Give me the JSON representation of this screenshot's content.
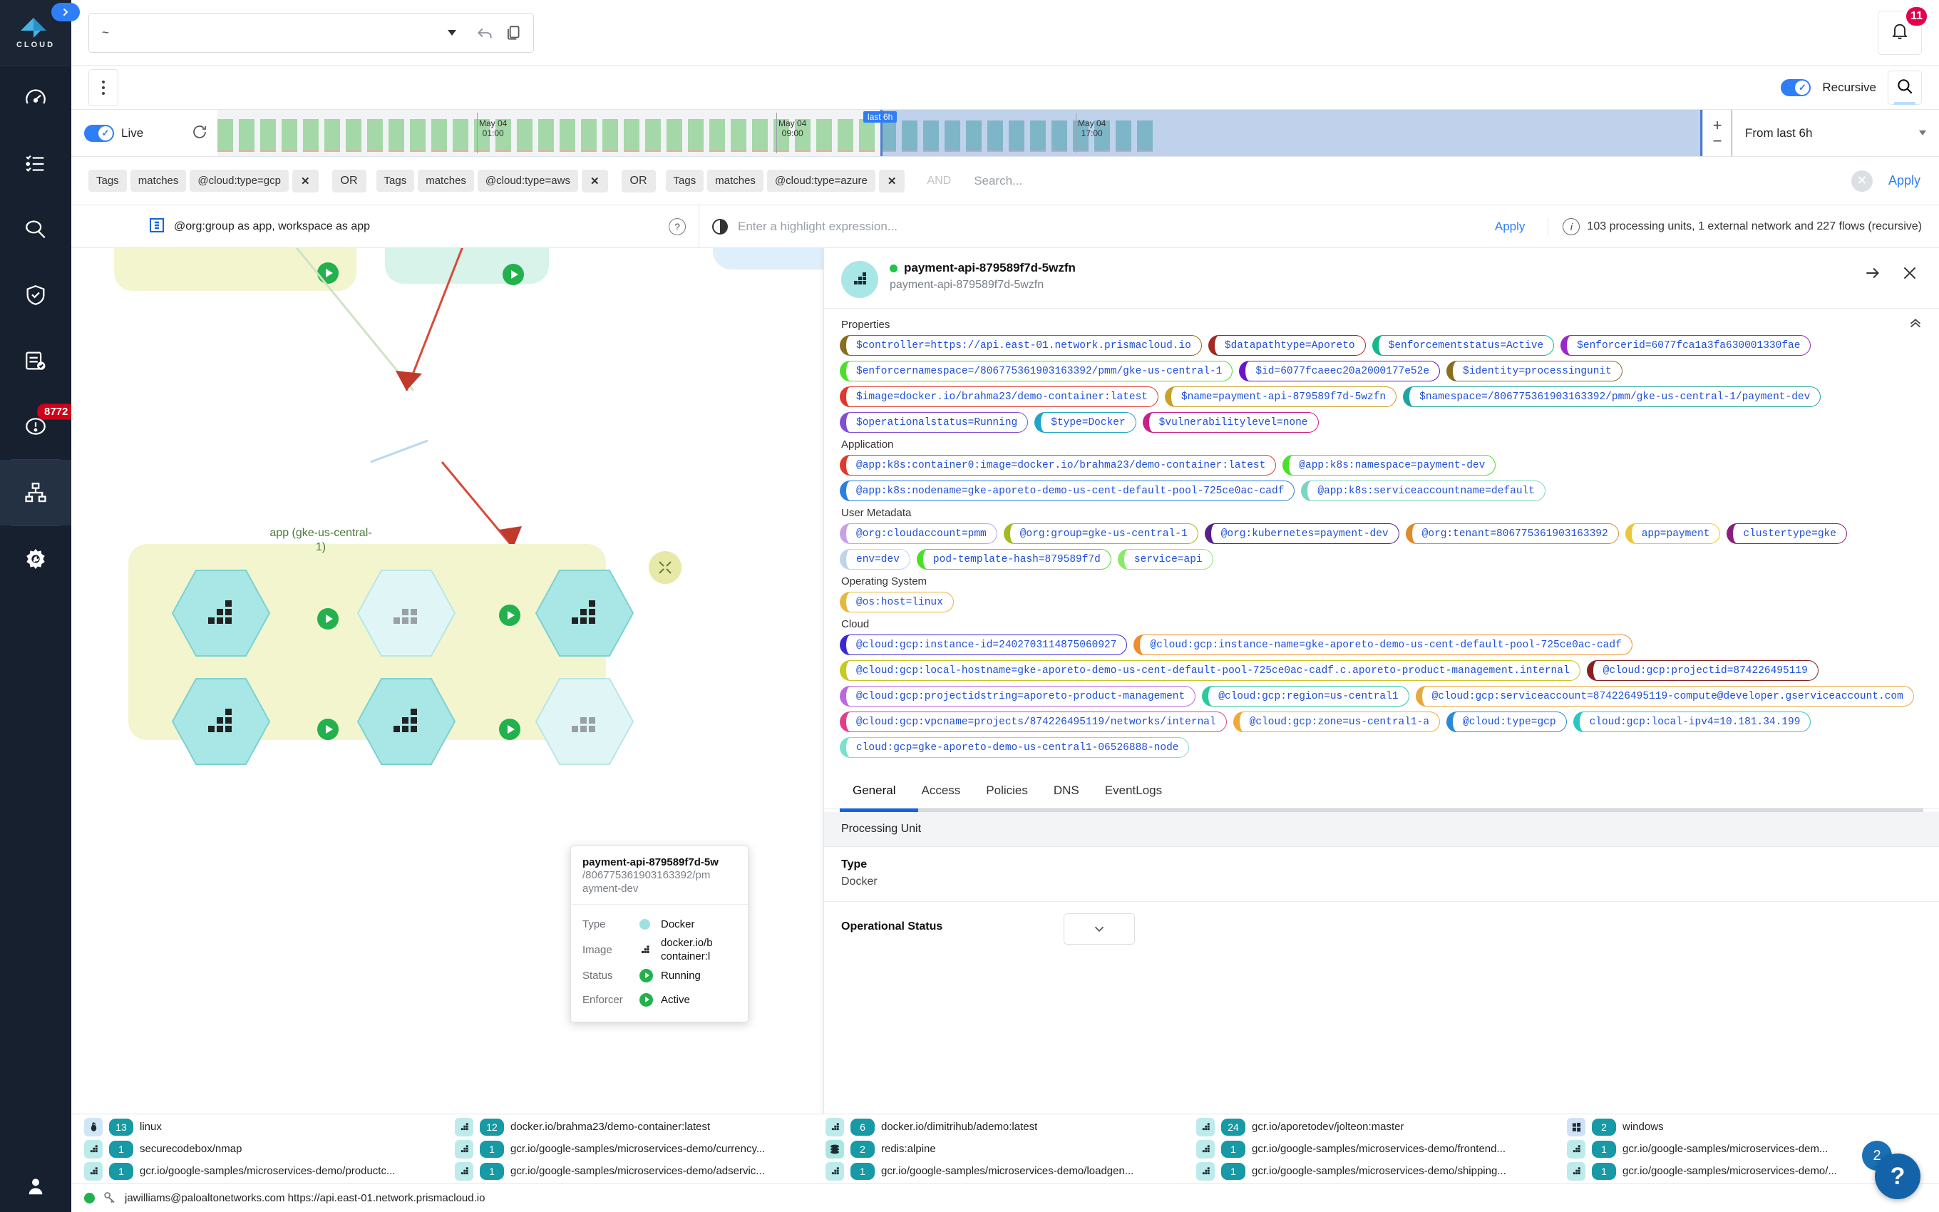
{
  "rail": {
    "logo_text": "CLOUD",
    "items": [
      {
        "name": "dashboard",
        "icon": "gauge-icon"
      },
      {
        "name": "inventory",
        "icon": "list-check-icon"
      },
      {
        "name": "investigate",
        "icon": "magnifier-icon"
      },
      {
        "name": "compliance",
        "icon": "shield-check-icon"
      },
      {
        "name": "reports",
        "icon": "document-check-icon"
      },
      {
        "name": "alerts",
        "icon": "alert-circle-icon",
        "badge": "8772"
      },
      {
        "name": "network-map",
        "icon": "network-topology-icon",
        "active": true
      },
      {
        "name": "settings",
        "icon": "gear-wrench-icon"
      }
    ],
    "expander_icon": "chevron-right-icon",
    "user_icon": "user-avatar-icon"
  },
  "topbar": {
    "scope_value": "~",
    "undo_icon": "undo-arrow-icon",
    "copy_icon": "copy-icon",
    "bell_icon": "bell-icon",
    "bell_badge": "11"
  },
  "subbar": {
    "kebab_icon": "more-vertical-icon",
    "recursive_label": "Recursive",
    "recursive_on": true,
    "search_icon": "search-icon"
  },
  "timeline": {
    "live_label": "Live",
    "live_on": true,
    "refresh_icon": "refresh-icon",
    "selection_badge": "last 6h",
    "tick_left_label_1": "May 04",
    "tick_left_label_2": "01:00",
    "tick_mid_label_1": "May 04",
    "tick_mid_label_2": "09:00",
    "tick_right_label_1": "May 04",
    "tick_right_label_2": "17:00",
    "zoom_in": "+",
    "zoom_out": "−",
    "range_label": "From last 6h"
  },
  "query": {
    "groups": [
      {
        "field": "Tags",
        "op": "matches",
        "value": "@cloud:type=gcp",
        "remove": "✕",
        "joiner": "OR"
      },
      {
        "field": "Tags",
        "op": "matches",
        "value": "@cloud:type=aws",
        "remove": "✕",
        "joiner": "OR"
      },
      {
        "field": "Tags",
        "op": "matches",
        "value": "@cloud:type=azure",
        "remove": "✕",
        "joiner": "AND"
      }
    ],
    "search_placeholder": "Search...",
    "clear_icon": "✕",
    "apply_label": "Apply"
  },
  "highlight": {
    "scope_icon": "workspace-icon",
    "scope_text": "@org:group as app,  workspace as app",
    "help_icon": "?",
    "contrast_icon": "contrast-icon",
    "expression_placeholder": "Enter a highlight expression...",
    "apply_label": "Apply",
    "info_icon": "info-icon",
    "info_text": "103 processing units, 1 external network and 227 flows (recursive)"
  },
  "graph": {
    "group_label_line1": "app (gke-us-central-",
    "group_label_line2": "1)",
    "collapse_icon": "collapse-arrows-icon",
    "tooltip": {
      "title": "payment-api-879589f7d-5w",
      "subtitle": "/806775361903163392/pm\nayment-dev",
      "rows": [
        {
          "key": "Type",
          "icon": "teal-dot-icon",
          "value": "Docker"
        },
        {
          "key": "Image",
          "icon": "container-icon",
          "value": "docker.io/b\ncontainer:l"
        },
        {
          "key": "Status",
          "icon": "running-icon",
          "value": "Running"
        },
        {
          "key": "Enforcer",
          "icon": "running-icon",
          "value": "Active"
        }
      ]
    }
  },
  "detail": {
    "avatar_icon": "container-icon",
    "title": "payment-api-879589f7d-5wzfn",
    "subtitle": "payment-api-879589f7d-5wzfn",
    "status_dot_color": "#21c14a",
    "expand_icon": "arrow-right-icon",
    "close_icon": "✕",
    "collapse_icon": "chevron-double-up-icon",
    "sections": [
      {
        "label": "Properties",
        "chips": [
          {
            "text": "$controller=https://api.east-01.network.prismacloud.io",
            "color": "#8a6d1f"
          },
          {
            "text": "$datapathtype=Aporeto",
            "color": "#a22a22"
          },
          {
            "text": "$enforcementstatus=Active",
            "color": "#14b88a"
          },
          {
            "text": "$enforcerid=6077fca1a3fa630001330fae",
            "color": "#9b28c9"
          },
          {
            "text": "$enforcernamespace=/806775361903163392/pmm/gke-us-central-1",
            "color": "#4cdf2a"
          },
          {
            "text": "$id=6077fcaeec20a2000177e52e",
            "color": "#6c14c9"
          },
          {
            "text": "$identity=processingunit",
            "color": "#8a6d1f"
          },
          {
            "text": "$image=docker.io/brahma23/demo-container:latest",
            "color": "#e0382c"
          },
          {
            "text": "$name=payment-api-879589f7d-5wzfn",
            "color": "#c9a227"
          },
          {
            "text": "$namespace=/806775361903163392/pmm/gke-us-central-1/payment-dev",
            "color": "#1fa5a0"
          },
          {
            "text": "$operationalstatus=Running",
            "color": "#7f4fd6"
          },
          {
            "text": "$type=Docker",
            "color": "#1fa5c9"
          },
          {
            "text": "$vulnerabilitylevel=none",
            "color": "#c9208a"
          }
        ]
      },
      {
        "label": "Application",
        "chips": [
          {
            "text": "@app:k8s:container0:image=docker.io/brahma23/demo-container:latest",
            "color": "#e03a2c"
          },
          {
            "text": "@app:k8s:namespace=payment-dev",
            "color": "#4cdf2a"
          },
          {
            "text": "@app:k8s:nodename=gke-aporeto-demo-us-cent-default-pool-725ce0ac-cadf",
            "color": "#2c7fe0"
          },
          {
            "text": "@app:k8s:serviceaccountname=default",
            "color": "#7ad6c2"
          }
        ]
      },
      {
        "label": "User Metadata",
        "chips": [
          {
            "text": "@org:cloudaccount=pmm",
            "color": "#c9a0e8"
          },
          {
            "text": "@org:group=gke-us-central-1",
            "color": "#a8b820"
          },
          {
            "text": "@org:kubernetes=payment-dev",
            "color": "#5a1f8a"
          },
          {
            "text": "@org:tenant=806775361903163392",
            "color": "#e08a2c"
          },
          {
            "text": "app=payment",
            "color": "#e8c83a"
          },
          {
            "text": "clustertype=gke",
            "color": "#8a1f7a"
          },
          {
            "text": "env=dev",
            "color": "#bdd4ea"
          },
          {
            "text": "pod-template-hash=879589f7d",
            "color": "#4cdf2a"
          },
          {
            "text": "service=api",
            "color": "#8ae86a"
          }
        ]
      },
      {
        "label": "Operating System",
        "chips": [
          {
            "text": "@os:host=linux",
            "color": "#e8b83a"
          }
        ]
      },
      {
        "label": "Cloud",
        "chips": [
          {
            "text": "@cloud:gcp:instance-id=2402703114875060927",
            "color": "#3a28d6"
          },
          {
            "text": "@cloud:gcp:instance-name=gke-aporeto-demo-us-cent-default-pool-725ce0ac-cadf",
            "color": "#f08c2a"
          },
          {
            "text": "@cloud:gcp:local-hostname=gke-aporeto-demo-us-cent-default-pool-725ce0ac-cadf.c.aporeto-product-management.internal",
            "color": "#c9c820"
          },
          {
            "text": "@cloud:gcp:projectid=874226495119",
            "color": "#8a1f1f"
          },
          {
            "text": "@cloud:gcp:projectidstring=aporeto-product-management",
            "color": "#b86ae0"
          },
          {
            "text": "@cloud:gcp:region=us-central1",
            "color": "#2ac9a0"
          },
          {
            "text": "@cloud:gcp:serviceaccount=874226495119-compute@developer.gserviceaccount.com",
            "color": "#e8a83a"
          },
          {
            "text": "@cloud:gcp:vpcname=projects/874226495119/networks/internal",
            "color": "#e0408a"
          },
          {
            "text": "@cloud:gcp:zone=us-central1-a",
            "color": "#f0a83a"
          },
          {
            "text": "@cloud:type=gcp",
            "color": "#2a8ad6"
          },
          {
            "text": "cloud:gcp:local-ipv4=10.181.34.199",
            "color": "#2ac9c0"
          },
          {
            "text": "cloud:gcp=gke-aporeto-demo-us-central1-06526888-node",
            "color": "#7ae0d0"
          }
        ]
      }
    ],
    "tabs": [
      {
        "label": "General",
        "active": true
      },
      {
        "label": "Access",
        "active": false
      },
      {
        "label": "Policies",
        "active": false
      },
      {
        "label": "DNS",
        "active": false
      },
      {
        "label": "EventLogs",
        "active": false
      }
    ],
    "section_title": "Processing Unit",
    "fields": [
      {
        "key": "Type",
        "value": "Docker"
      },
      {
        "key": "Operational Status",
        "value": ""
      }
    ],
    "chev_icon": "chevron-down-icon"
  },
  "legend": {
    "items": [
      {
        "icon": "linux-icon",
        "count": "13",
        "label": "linux"
      },
      {
        "icon": "container-icon",
        "count": "12",
        "label": "docker.io/brahma23/demo-container:latest"
      },
      {
        "icon": "container-icon",
        "count": "6",
        "label": "docker.io/dimitrihub/ademo:latest"
      },
      {
        "icon": "container-icon",
        "count": "24",
        "label": "gcr.io/aporetodev/jolteon:master"
      },
      {
        "icon": "windows-icon",
        "count": "2",
        "label": "windows"
      },
      {
        "icon": "container-icon",
        "count": "1",
        "label": "securecodebox/nmap"
      },
      {
        "icon": "container-icon",
        "count": "1",
        "label": "gcr.io/google-samples/microservices-demo/currency..."
      },
      {
        "icon": "redis-icon",
        "count": "2",
        "label": "redis:alpine"
      },
      {
        "icon": "container-icon",
        "count": "1",
        "label": "gcr.io/google-samples/microservices-demo/frontend..."
      },
      {
        "icon": "container-icon",
        "count": "1",
        "label": "gcr.io/google-samples/microservices-dem..."
      },
      {
        "icon": "container-icon",
        "count": "1",
        "label": "gcr.io/google-samples/microservices-demo/productc..."
      },
      {
        "icon": "container-icon",
        "count": "1",
        "label": "gcr.io/google-samples/microservices-demo/adservic..."
      },
      {
        "icon": "container-icon",
        "count": "1",
        "label": "gcr.io/google-samples/microservices-demo/loadgen..."
      },
      {
        "icon": "container-icon",
        "count": "1",
        "label": "gcr.io/google-samples/microservices-demo/shipping..."
      },
      {
        "icon": "container-icon",
        "count": "1",
        "label": "gcr.io/google-samples/microservices-demo/..."
      }
    ]
  },
  "statusbar": {
    "key_icon": "key-icon",
    "text": "jawilliams@paloaltonetworks.com https://api.east-01.network.prismacloud.io"
  },
  "help": {
    "label": "?",
    "badge": "2"
  }
}
